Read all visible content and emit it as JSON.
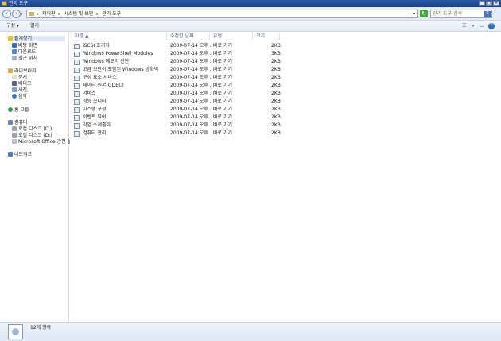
{
  "window": {
    "title": "관리 도구"
  },
  "address": {
    "crumbs": [
      "제어판",
      "시스템 및 보안",
      "관리 도구"
    ],
    "separator": "▸",
    "search_placeholder": "관리 도구 검색"
  },
  "toolbar": {
    "organize": "구성 ▾",
    "open": "열기"
  },
  "sidebar": {
    "favorites": {
      "label": "즐겨찾기",
      "items": [
        "바탕 화면",
        "다운로드",
        "최근 위치"
      ]
    },
    "libraries": {
      "label": "라이브러리",
      "items": [
        "문서",
        "비디오",
        "사진",
        "음악"
      ]
    },
    "homegroup": {
      "label": "홈 그룹"
    },
    "computer": {
      "label": "컴퓨터",
      "items": [
        "로컬 디스크 (C:)",
        "로컬 디스크 (D:)",
        "Microsoft Office 간편 실"
      ]
    },
    "network": {
      "label": "네트워크"
    }
  },
  "list": {
    "columns": [
      "이름 ▲",
      "수정한 날짜",
      "유형",
      "크기"
    ],
    "rows": [
      {
        "name": "iSCSI 초기자",
        "date": "2009-07-14 오후 ...",
        "type": "바로 가기",
        "size": "2KB"
      },
      {
        "name": "Windows PowerShell Modules",
        "date": "2009-07-14 오후 ...",
        "type": "바로 가기",
        "size": "3KB"
      },
      {
        "name": "Windows 메모리 진단",
        "date": "2009-07-14 오후 ...",
        "type": "바로 가기",
        "size": "2KB"
      },
      {
        "name": "고급 보안이 포함된 Windows 방화벽",
        "date": "2009-07-14 오후 ...",
        "type": "바로 가기",
        "size": "2KB"
      },
      {
        "name": "구성 요소 서비스",
        "date": "2009-07-14 오후 ...",
        "type": "바로 가기",
        "size": "2KB"
      },
      {
        "name": "데이터 원본(ODBC)",
        "date": "2009-07-14 오후 ...",
        "type": "바로 가기",
        "size": "2KB"
      },
      {
        "name": "서비스",
        "date": "2009-07-14 오후 ...",
        "type": "바로 가기",
        "size": "2KB"
      },
      {
        "name": "성능 모니터",
        "date": "2009-07-14 오후 ...",
        "type": "바로 가기",
        "size": "2KB"
      },
      {
        "name": "시스템 구성",
        "date": "2009-07-14 오후 ...",
        "type": "바로 가기",
        "size": "2KB"
      },
      {
        "name": "이벤트 뷰어",
        "date": "2009-07-14 오후 ...",
        "type": "바로 가기",
        "size": "2KB"
      },
      {
        "name": "작업 스케줄러",
        "date": "2009-07-14 오후 ...",
        "type": "바로 가기",
        "size": "2KB"
      },
      {
        "name": "컴퓨터 관리",
        "date": "2009-07-14 오후 ...",
        "type": "바로 가기",
        "size": "2KB"
      }
    ]
  },
  "status": {
    "count": "12개 항목"
  }
}
